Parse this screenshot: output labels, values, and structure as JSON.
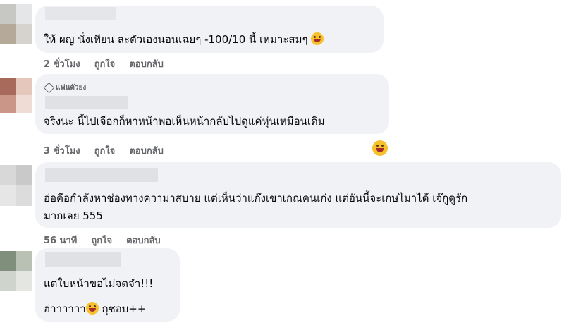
{
  "comments": [
    {
      "text_lines": [
        "ให้ ผญ นั่งเทียน ละตัวเองนอนเฉยๆ -100/10 นี้ เหมาะสมๆ"
      ],
      "emoji": "laughing-crying-emoji",
      "time": "2 ชั่วโมง",
      "like": "ถูกใจ",
      "reply": "ตอบกลับ"
    },
    {
      "badge": "แฟนตัวยง",
      "text_lines": [
        "จริงนะ นี้ไปเจือกก็หาหน้าพอเห็นหน้ากลับไปดูแค่หุ่นเหมือนเดิม"
      ],
      "time": "3 ชั่วโมง",
      "like": "ถูกใจ",
      "reply": "ตอบกลับ",
      "reaction": "laughing-emoji"
    },
    {
      "text_lines": [
        "อ่อคือกำลังหาช่องทางความาสบาย แต่เห็นว่าแก๊งเขาเกณคนเก่ง แต่อันนี้จะเกษไมาได้ เจ๊กูดูรัก",
        "มากเลย 555"
      ],
      "time": "56 นาที",
      "like": "ถูกใจ",
      "reply": "ตอบกลับ"
    },
    {
      "text_lines": [
        "แต่ใบหน้าขอไม่จดจำ!!!",
        "ฮ่าาาาาา",
        "กุชอบ++"
      ],
      "emoji": "rolling-laughing-emoji"
    }
  ]
}
